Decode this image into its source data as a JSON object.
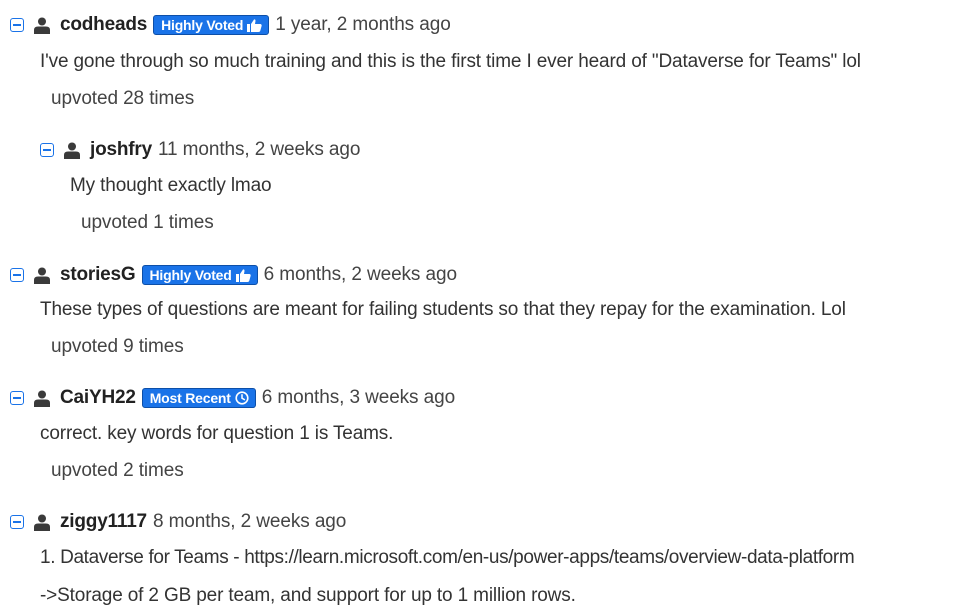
{
  "comments": [
    {
      "username": "codheads",
      "badge": "Highly Voted",
      "time": "1 year, 2 months ago",
      "text": "I've gone through so much training and this is the first time I ever heard of \"Dataverse for Teams\" lol",
      "votes": "upvoted 28 times"
    },
    {
      "username": "joshfry",
      "time": "11 months, 2 weeks ago",
      "text": "My thought exactly lmao",
      "votes": "upvoted 1 times"
    },
    {
      "username": "storiesG",
      "badge": "Highly Voted",
      "time": "6 months, 2 weeks ago",
      "text": "These types of questions are meant for failing students so that they repay for the examination. Lol",
      "votes": "upvoted 9 times"
    },
    {
      "username": "CaiYH22",
      "badge": "Most Recent",
      "time": "6 months, 3 weeks ago",
      "text": "correct. key words for question 1 is Teams.",
      "votes": "upvoted 2 times"
    },
    {
      "username": "ziggy1117",
      "time": "8 months, 2 weeks ago",
      "lines": [
        "1. Dataverse for Teams - https://learn.microsoft.com/en-us/power-apps/teams/overview-data-platform",
        "->Storage of 2 GB per team, and support for up to 1 million rows."
      ]
    }
  ],
  "colors": {
    "accent": "#1a73e8"
  },
  "icons": {
    "toggle": "collapse-icon",
    "user": "user-icon",
    "highly_voted": "thumbs-up-icon",
    "most_recent": "clock-icon"
  }
}
